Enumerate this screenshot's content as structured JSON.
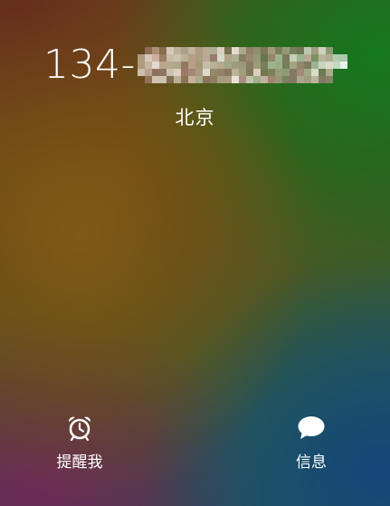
{
  "caller": {
    "number_prefix": "134-",
    "location": "北京"
  },
  "actions": {
    "remind_label": "提醒我",
    "message_label": "信息"
  },
  "icons": {
    "remind": "alarm-clock-icon",
    "message": "speech-bubble-icon"
  },
  "colors": {
    "text": "#ffffff"
  }
}
